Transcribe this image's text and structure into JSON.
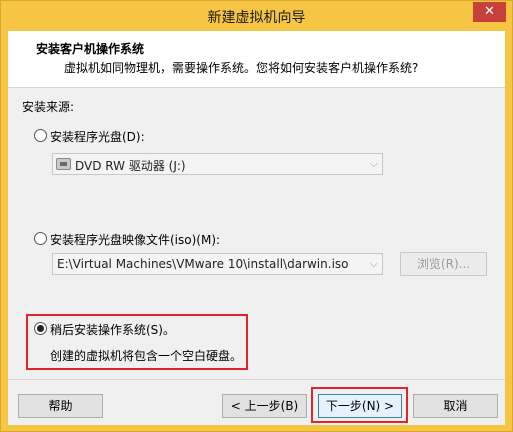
{
  "window": {
    "title": "新建虚拟机向导",
    "close_glyph": "✕"
  },
  "header": {
    "title": "安装客户机操作系统",
    "description": "虚拟机如同物理机，需要操作系统。您将如何安装客户机操作系统?"
  },
  "install_source": {
    "label": "安装来源:",
    "options": [
      {
        "label": "安装程序光盘(D):",
        "selected": false,
        "combo_value": "DVD RW 驱动器 (J:)"
      },
      {
        "label": "安装程序光盘映像文件(iso)(M):",
        "selected": false,
        "combo_value": "E:\\Virtual Machines\\VMware 10\\install\\darwin.iso",
        "browse_label": "浏览(R)..."
      },
      {
        "label": "稍后安装操作系统(S)。",
        "selected": true,
        "description": "创建的虚拟机将包含一个空白硬盘。"
      }
    ]
  },
  "buttons": {
    "help": "帮助",
    "back": "< 上一步(B)",
    "next": "下一步(N) >",
    "cancel": "取消"
  },
  "colors": {
    "titlebar": "#f7c544",
    "highlight": "#e0262d",
    "close": "#c7403a"
  }
}
